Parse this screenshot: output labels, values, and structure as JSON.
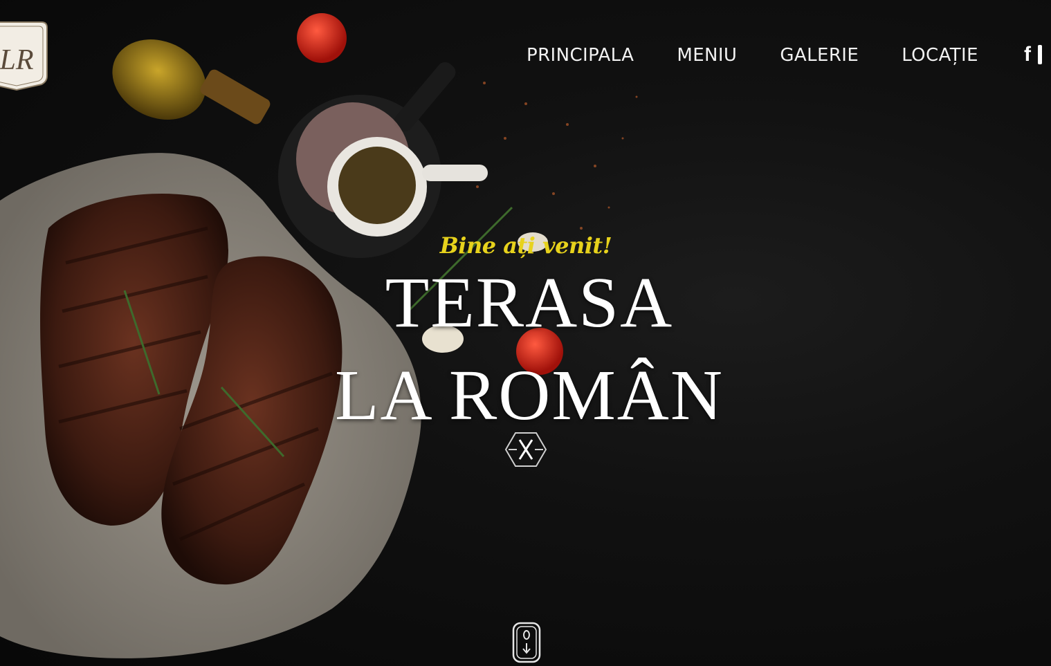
{
  "logo": {
    "text": "LR"
  },
  "nav": {
    "items": [
      "PRINCIPALA",
      "MENIU",
      "GALERIE",
      "LOCAȚIE"
    ]
  },
  "social": {
    "facebook": "f",
    "icons": [
      "facebook-icon",
      "instagram-icon"
    ]
  },
  "hero": {
    "welcome": "Bine ați venit!",
    "title_line1": "TERASA",
    "title_line2": "LA ROMÂN"
  },
  "colors": {
    "background": "#0b0b0b",
    "accent": "#e7d21c",
    "text": "#ffffff"
  }
}
